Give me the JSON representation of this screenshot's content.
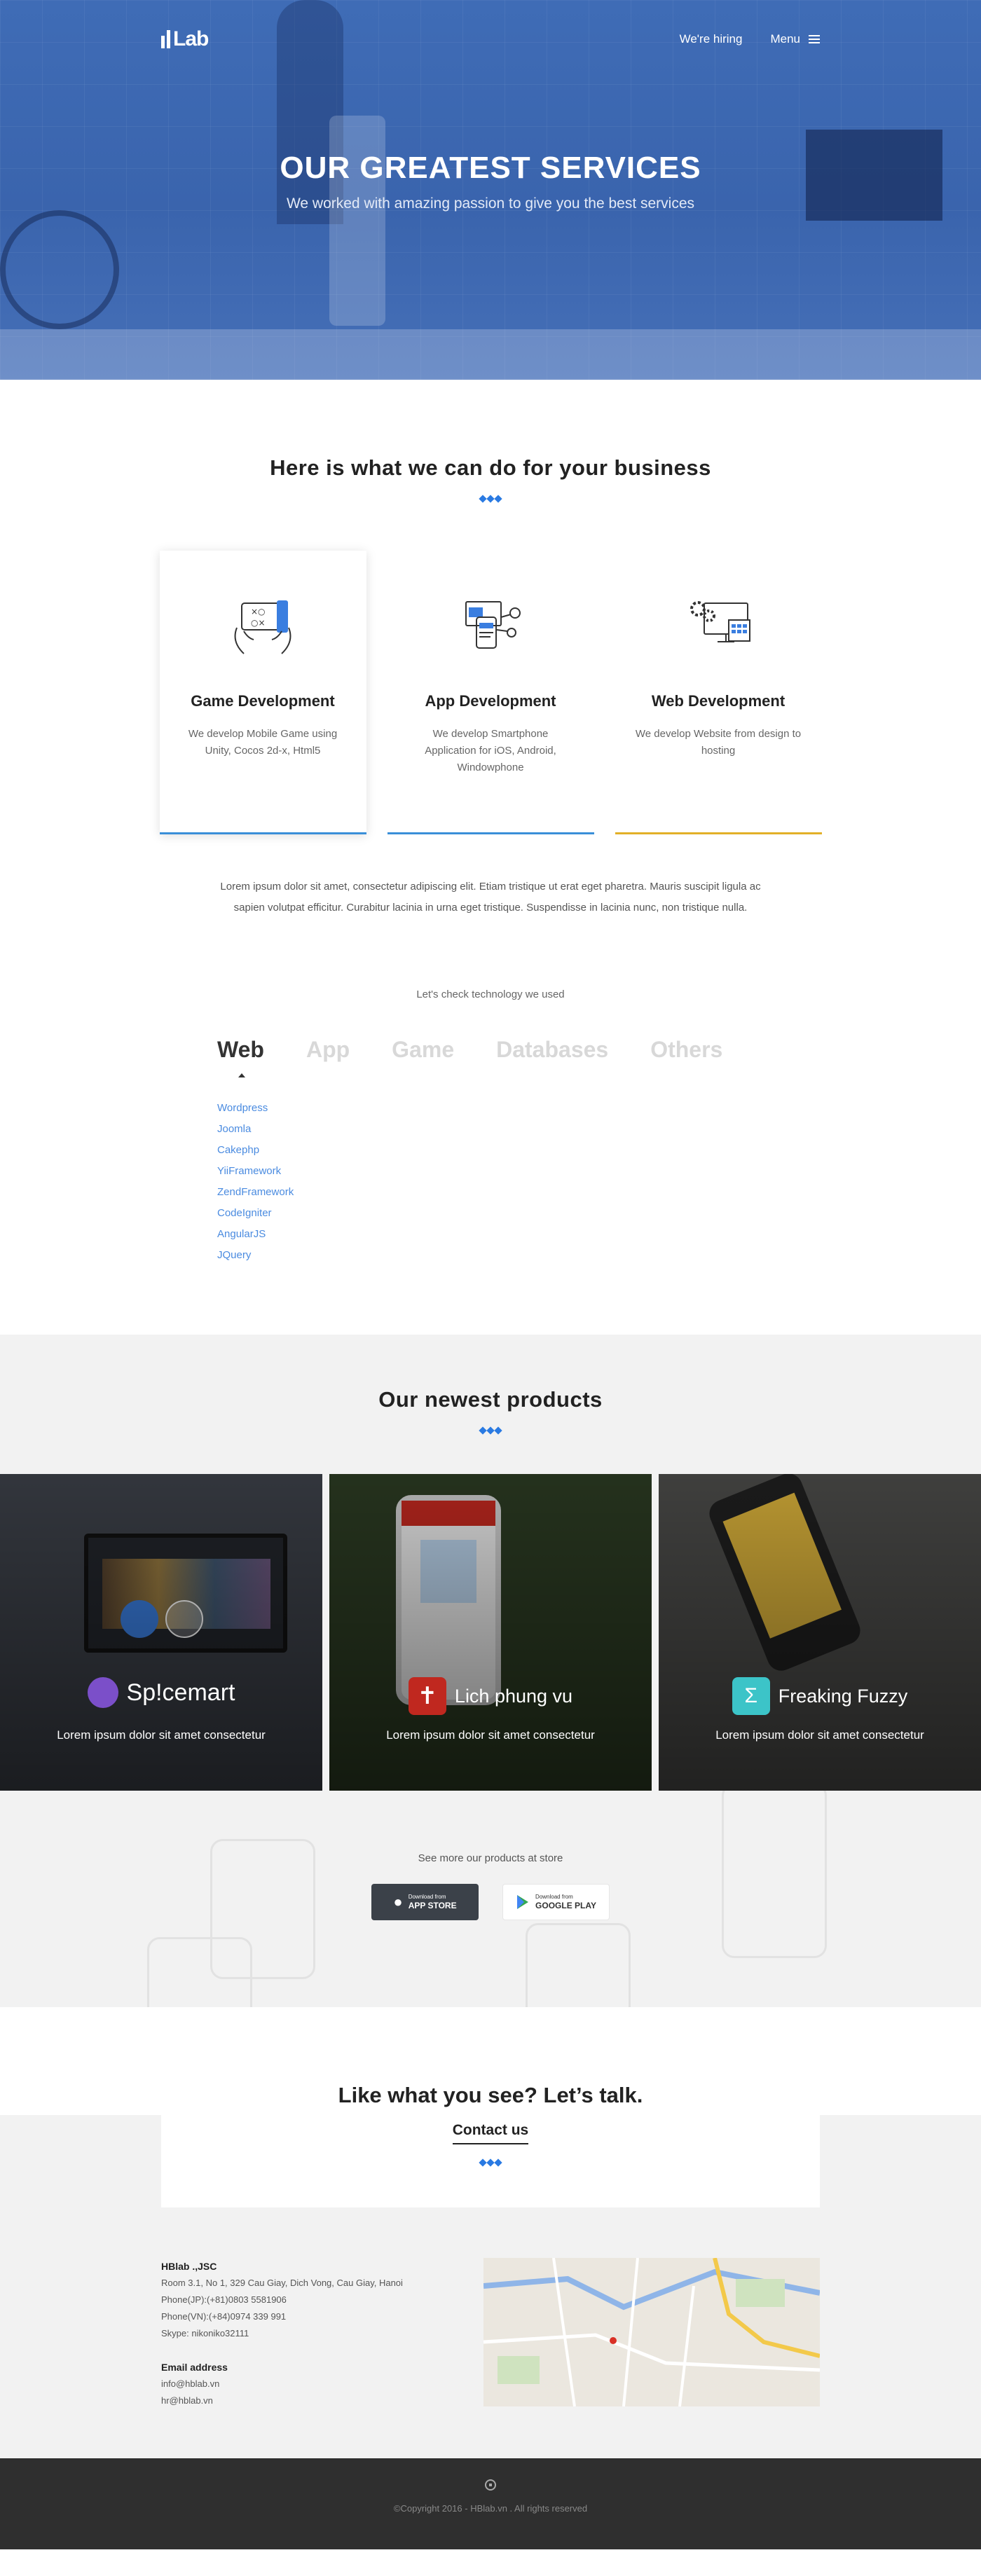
{
  "header": {
    "logo": "Lab",
    "logo_mark": "HB",
    "nav_hiring": "We're hiring",
    "nav_menu": "Menu"
  },
  "hero": {
    "title": "OUR GREATEST SERVICES",
    "subtitle": "We worked with amazing passion to give you the best services"
  },
  "services": {
    "title": "Here is what we can do for your business",
    "cards": [
      {
        "title": "Game Development",
        "desc": "We develop Mobile Game using Unity, Cocos 2d-x, Html5",
        "line_color": "#3a8fd8",
        "icon": "game-controller-icon"
      },
      {
        "title": "App Development",
        "desc": "We develop Smartphone Application for iOS, Android, Windowphone",
        "line_color": "#3a8fd8",
        "icon": "mobile-app-icon"
      },
      {
        "title": "Web Development",
        "desc": "We develop Website from design to hosting",
        "line_color": "#e2b028",
        "icon": "web-monitor-icon"
      }
    ],
    "lorem": "Lorem ipsum dolor sit amet, consectetur adipiscing elit. Etiam tristique ut erat eget pharetra. Mauris suscipit ligula ac sapien volutpat efficitur. Curabitur lacinia in urna eget tristique. Suspendisse in lacinia nunc, non tristique nulla."
  },
  "tech": {
    "heading": "Let's check technology we used",
    "tabs": [
      "Web",
      "App",
      "Game",
      "Databases",
      "Others"
    ],
    "active_tab": "Web",
    "items": [
      "Wordpress",
      "Joomla",
      "Cakephp",
      "YiiFramework",
      "ZendFramework",
      "CodeIgniter",
      "AngularJS",
      "JQuery"
    ]
  },
  "products": {
    "title": "Our newest products",
    "items": [
      {
        "name": "Sp!cemart",
        "desc": "Lorem ipsum dolor sit amet consectetur",
        "bg": "#3b3f47",
        "badge_color": "#7b4fc9"
      },
      {
        "name": "Lich phung vu",
        "desc": "Lorem ipsum dolor sit amet consectetur",
        "bg": "#2b3a22",
        "badge_color": "#c0281f"
      },
      {
        "name": "Freaking Fuzzy",
        "desc": "Lorem ipsum dolor sit amet consectetur",
        "bg": "#4a4a48",
        "badge_color": "#3cc4c8"
      }
    ],
    "store_text": "See more our products at store",
    "app_store_small": "Download from",
    "app_store_big": "APP STORE",
    "google_small": "Download from",
    "google_big": "GOOGLE PLAY"
  },
  "contact": {
    "title": "Like what you see? Let’s talk.",
    "link": "Contact us",
    "company": "HBlab .,JSC",
    "address": "Room 3.1, No 1, 329 Cau Giay, Dich Vong, Cau Giay, Hanoi",
    "phone_jp": "Phone(JP):(+81)0803 5581906",
    "phone_vn": "Phone(VN):(+84)0974 339 991",
    "skype": "Skype: nikoniko32111",
    "email_heading": "Email address",
    "email_1": "info@hblab.vn",
    "email_2": "hr@hblab.vn"
  },
  "footer": {
    "copyright": "©Copyright 2016 - HBlab.vn . All rights reserved"
  }
}
